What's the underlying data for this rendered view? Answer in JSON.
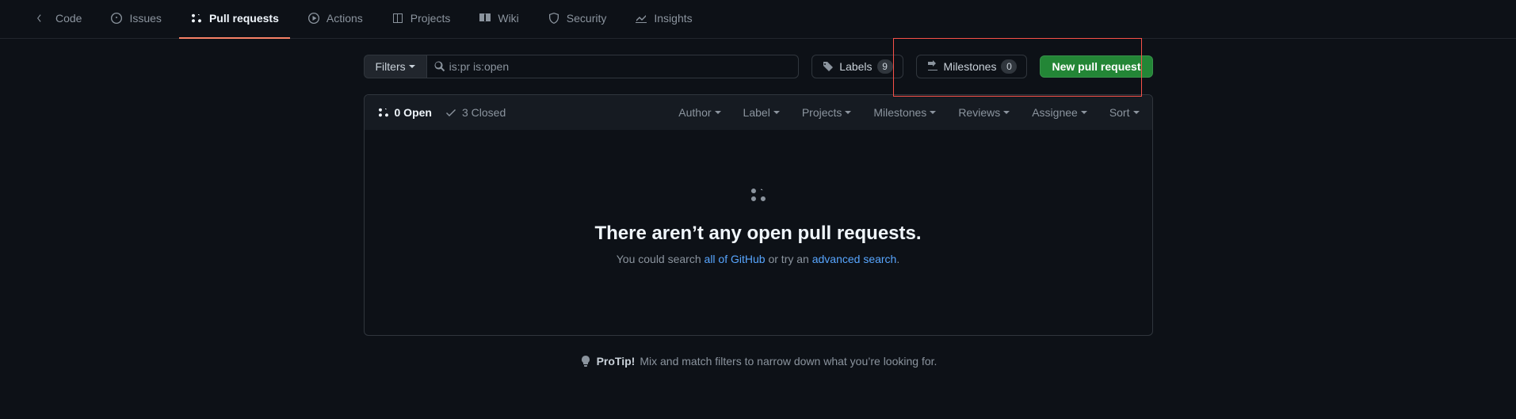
{
  "nav": {
    "code": "Code",
    "issues": "Issues",
    "pulls": "Pull requests",
    "actions": "Actions",
    "projects": "Projects",
    "wiki": "Wiki",
    "security": "Security",
    "insights": "Insights"
  },
  "toolbar": {
    "filters_label": "Filters",
    "search_value": "is:pr is:open",
    "labels_label": "Labels",
    "labels_count": "9",
    "milestones_label": "Milestones",
    "milestones_count": "0",
    "new_pr_label": "New pull request"
  },
  "list_header": {
    "open_label": "0 Open",
    "closed_label": "3 Closed",
    "filters": {
      "author": "Author",
      "label": "Label",
      "projects": "Projects",
      "milestones": "Milestones",
      "reviews": "Reviews",
      "assignee": "Assignee",
      "sort": "Sort"
    }
  },
  "empty": {
    "heading": "There aren’t any open pull requests.",
    "hint_pre": "You could search ",
    "hint_link1": "all of GitHub",
    "hint_mid": " or try an ",
    "hint_link2": "advanced search",
    "hint_post": "."
  },
  "protip": {
    "label": "ProTip!",
    "text": "Mix and match filters to narrow down what you’re looking for."
  }
}
